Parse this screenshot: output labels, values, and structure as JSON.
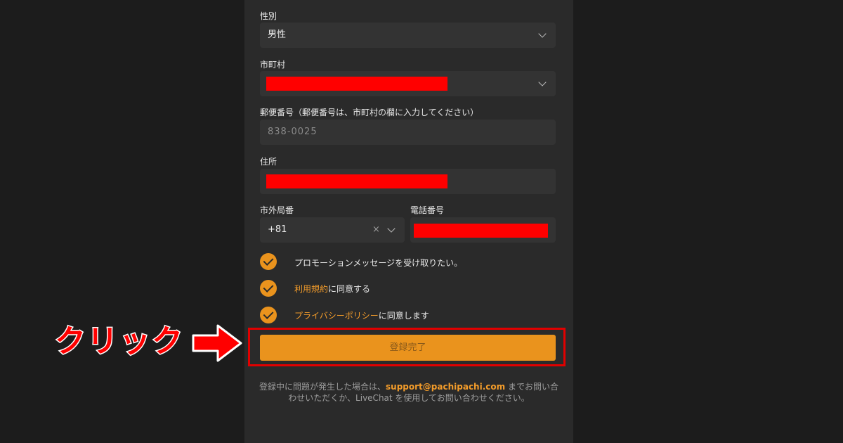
{
  "form": {
    "gender": {
      "label": "性別",
      "value": "男性"
    },
    "city": {
      "label": "市町村"
    },
    "postal": {
      "label": "郵便番号（郵便番号は、市町村の欄に入力してください）",
      "placeholder": "838-0025"
    },
    "address": {
      "label": "住所"
    },
    "area_code": {
      "label": "市外局番",
      "value": "+81",
      "clear": "×"
    },
    "phone": {
      "label": "電話番号"
    }
  },
  "checks": {
    "promo": {
      "text": "プロモーションメッセージを受け取りたい。"
    },
    "terms": {
      "link": "利用規約",
      "text": "に同意する"
    },
    "privacy": {
      "link": "プライバシーポリシー",
      "text": "に同意します"
    }
  },
  "submit": {
    "label": "登録完了"
  },
  "annotation": {
    "click_label": "クリック"
  },
  "footer": {
    "prefix": "登録中に問題が発生した場合は、",
    "email": "support@pachipachi.com",
    "suffix": " までお問い合わせいただくか、LiveChat を使用してお問い合わせください。"
  },
  "colors": {
    "accent": "#ea931d",
    "redaction": "#ff0000",
    "panel": "#2a2a2a",
    "background": "#1c1c1c"
  }
}
